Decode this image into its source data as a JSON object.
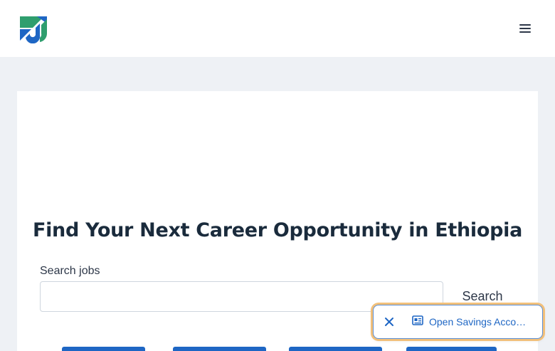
{
  "header": {
    "logo_icon": "ethiojobs-logo-icon",
    "menu_icon": "hamburger-menu-icon"
  },
  "main": {
    "title": "Find Your Next Career Opportunity in Ethiopia",
    "search_label": "Search jobs",
    "search_value": "",
    "search_button": "Search"
  },
  "promo": {
    "close_icon": "close-icon",
    "card_icon": "id-card-icon",
    "label": "Open Savings Acco…"
  },
  "colors": {
    "brand_blue": "#1e66c4",
    "brand_green": "#2f9e6e",
    "promo_border": "#5b8fd6",
    "promo_glow": "#f2c07a"
  }
}
